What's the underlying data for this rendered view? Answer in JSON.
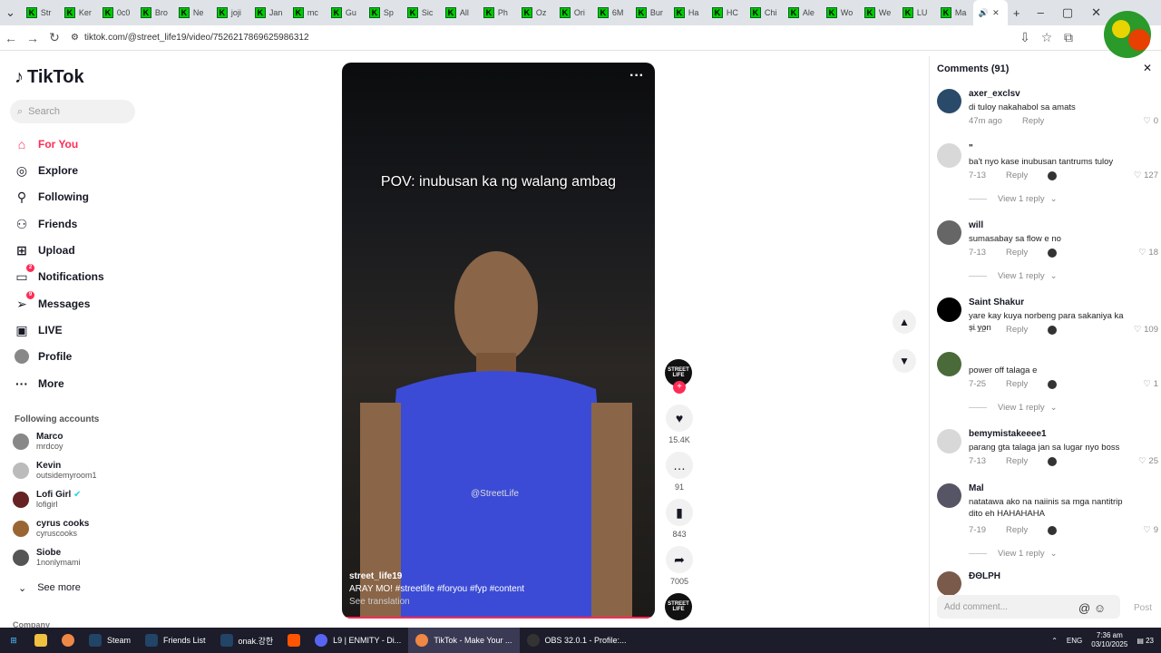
{
  "browser": {
    "tabs": [
      "Str",
      "Ker",
      "0c0",
      "Bro",
      "Ne",
      "joji",
      "Jan",
      "mc",
      "Gu",
      "Sp",
      "Sic",
      "All",
      "Ph",
      "Oz",
      "Ori",
      "6M",
      "Bur",
      "Ha",
      "HC",
      "Chi",
      "Ale",
      "Wo",
      "We",
      "LU",
      "Ma"
    ],
    "active_tab_icon": "speaker-icon",
    "new_tab": "+",
    "url": "tiktok.com/@street_life19/video/7526217869625986312"
  },
  "sidebar": {
    "logo": "TikTok",
    "search_placeholder": "Search",
    "items": [
      {
        "label": "For You",
        "icon": "home-icon",
        "active": true,
        "badge": ""
      },
      {
        "label": "Explore",
        "icon": "compass-icon",
        "badge": ""
      },
      {
        "label": "Following",
        "icon": "following-icon",
        "badge": ""
      },
      {
        "label": "Friends",
        "icon": "friends-icon",
        "badge": ""
      },
      {
        "label": "Upload",
        "icon": "upload-icon",
        "badge": ""
      },
      {
        "label": "Notifications",
        "icon": "inbox-icon",
        "badge": "2"
      },
      {
        "label": "Messages",
        "icon": "send-icon",
        "badge": "9"
      },
      {
        "label": "LIVE",
        "icon": "live-icon",
        "badge": ""
      },
      {
        "label": "Profile",
        "icon": "profile-icon",
        "badge": ""
      },
      {
        "label": "More",
        "icon": "more-icon",
        "badge": ""
      }
    ],
    "following_title": "Following accounts",
    "accounts": [
      {
        "name": "Marco",
        "handle": "mrdcoy"
      },
      {
        "name": "Kevin",
        "handle": "outsidemyroom1"
      },
      {
        "name": "Lofi Girl",
        "handle": "lofigirl",
        "verified": true
      },
      {
        "name": "cyrus cooks",
        "handle": "cyruscooks"
      },
      {
        "name": "Siobe",
        "handle": "1nonlymami"
      }
    ],
    "see_more": "See more",
    "company": "Company"
  },
  "video": {
    "overlay_text": "POV: inubusan ka ng walang ambag",
    "watermark": "@StreetLife",
    "username": "street_life19",
    "caption": "ARAY MO! #streetlife  #foryou  #fyp  #content",
    "see_translation": "See translation",
    "more": "···",
    "creator_avatar_text": "STREET LIFE"
  },
  "actions": {
    "likes": "15.4K",
    "comments": "91",
    "saves": "843",
    "shares": "7005"
  },
  "comments": {
    "title": "Comments (91)",
    "input_placeholder": "Add comment...",
    "post": "Post",
    "list": [
      {
        "user": "axer_exclsv",
        "text": "di tuloy nakahabol sa amats",
        "time": "47m ago",
        "likes": "0",
        "replies": "",
        "avatar": "#2a4a6a"
      },
      {
        "user": "\"",
        "text": "ba't nyo kase inubusan tantrums tuloy",
        "time": "7-13",
        "likes": "127",
        "replies": "View 1 reply",
        "avatar": "#d8d8d8"
      },
      {
        "user": "will",
        "text": "sumasabay sa flow e no",
        "time": "7-13",
        "likes": "18",
        "replies": "View 1 reply",
        "avatar": "#666"
      },
      {
        "user": "Saint Shakur",
        "text": "yare kay kuya norbeng para sakaniya ka si yon",
        "time": "7-12",
        "likes": "109",
        "replies": "",
        "avatar": "#000"
      },
      {
        "user": "",
        "text": "power off talaga e",
        "time": "7-25",
        "likes": "1",
        "replies": "View 1 reply",
        "avatar": "#4a6a3a"
      },
      {
        "user": "bemymistakeeee1",
        "text": "parang gta talaga jan sa lugar nyo boss",
        "time": "7-13",
        "likes": "25",
        "replies": "",
        "avatar": "#d8d8d8"
      },
      {
        "user": "Mal",
        "text": "natatawa ako na naiinis sa mga nantitrip dito eh HAHAHAHA",
        "time": "7-19",
        "likes": "9",
        "replies": "View 1 reply",
        "avatar": "#556"
      },
      {
        "user": "ÐΘLPH",
        "text": "",
        "time": "",
        "likes": "",
        "replies": "",
        "avatar": "#7a5a4a"
      }
    ],
    "reply_label": "Reply"
  },
  "taskbar": {
    "items": [
      "Steam",
      "Friends List",
      "onak.강한",
      "",
      "L9 | ENMITY - Di...",
      "TikTok - Make Your ...",
      "OBS 32.0.1 - Profile:..."
    ],
    "lang": "ENG",
    "time": "7:36 am",
    "date": "03/10/2025",
    "notif": "23"
  },
  "colors": {
    "accent": "#fe2c55",
    "video_shirt": "#3b4bd6"
  }
}
